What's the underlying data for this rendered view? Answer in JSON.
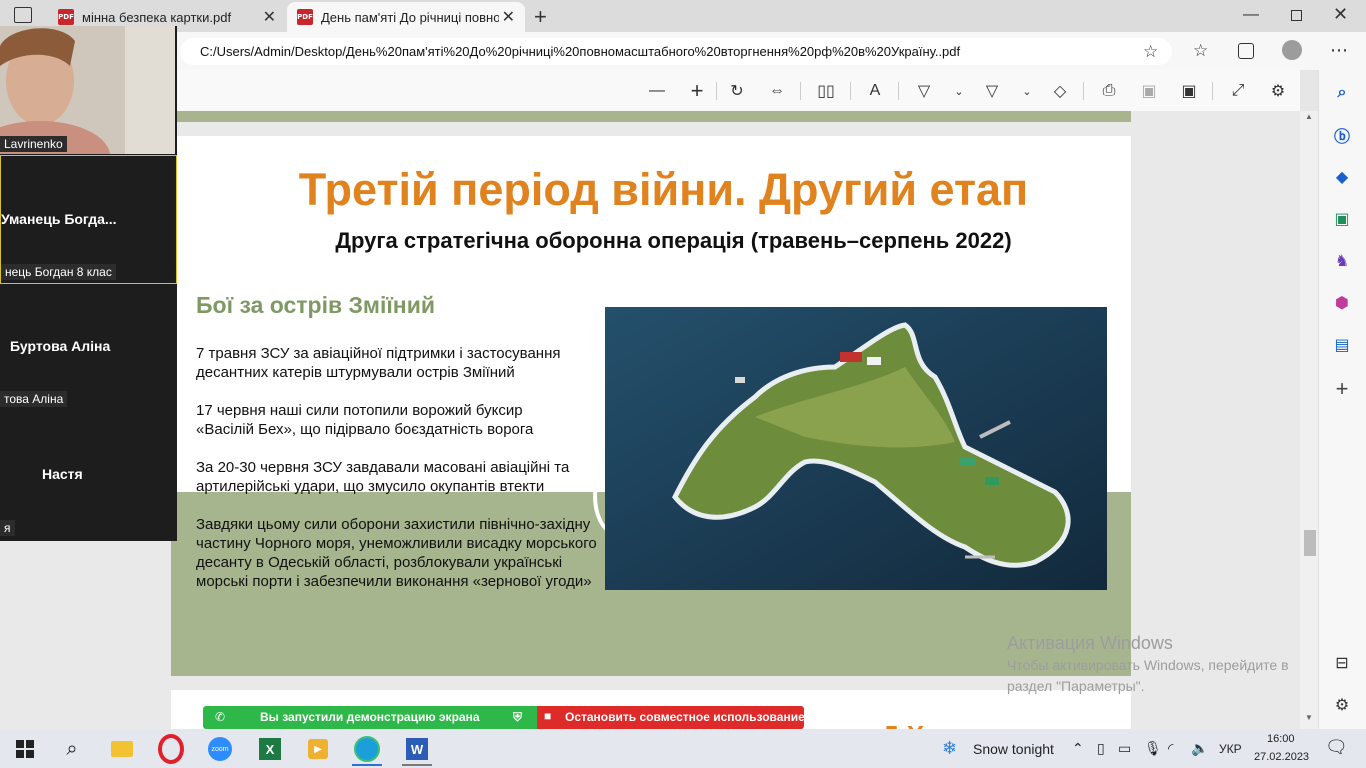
{
  "browser": {
    "tabs": [
      {
        "label": "мінна безпека картки.pdf",
        "active": false
      },
      {
        "label": "День пам'яті До річниці повном",
        "active": true
      }
    ],
    "pdf_badge": "PDF",
    "address": "C:/Users/Admin/Desktop/День%20пам'яті%20До%20річниці%20повномасштабного%20вторгнення%20рф%20в%20Україну..pdf"
  },
  "zoom": {
    "self_label": "Lavrinenko",
    "participants": [
      {
        "name": "Уманець  Богда...",
        "label": "нець Богдан 8 клас"
      },
      {
        "name": "Буртова Аліна",
        "label": "това Аліна"
      },
      {
        "name": "Настя",
        "label": "я"
      }
    ]
  },
  "slide": {
    "title": "Третій період війни. Другий етап",
    "subtitle": "Друга стратегічна оборонна операція (травень–серпень 2022)",
    "section": "Бої за острів Зміїний",
    "paragraphs": [
      "7 травня ЗСУ за авіаційної підтримки і застосування десантних катерів штурмували острів Зміїний",
      "17 червня наші сили потопили ворожий буксир «Васілій Бех», що підірвало боєздатність ворога",
      "За 20-30 червня ЗСУ завдавали масовані авіаційні та артилерійські удари, що змусило окупантів втекти",
      "Завдяки цьому сили оборони захистили північно-західну частину Чорного моря, унеможливили висадку морського десанту в Одеській області, розблокували українські морські порти і забезпечили виконання «зернової угоди»"
    ],
    "next_page_fragment": "Д Х"
  },
  "share": {
    "running": "Вы запустили демонстрацию экрана",
    "stop": "Остановить совместное использование"
  },
  "watermark": {
    "line1": "Активация Windows",
    "line2": "Чтобы активировать Windows, перейдите в",
    "line3": "раздел \"Параметры\"."
  },
  "taskbar": {
    "weather": "Snow tonight",
    "lang": "УКР",
    "time": "16:00",
    "date": "27.02.2023"
  },
  "colors": {
    "title": "#e0821d",
    "section": "#7f9965",
    "green_band": "#a7b58e",
    "share_green": "#2fb84a",
    "share_red": "#df2a2a"
  }
}
